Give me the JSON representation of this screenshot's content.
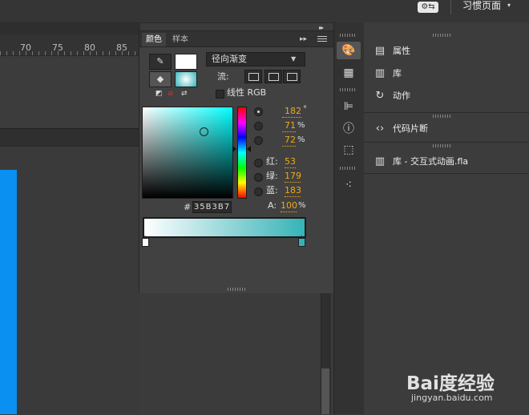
{
  "topbar": {
    "sync_icon": "gear-sync-icon",
    "workspace_label": "习惯页面",
    "workspace_caret": "▾"
  },
  "ruler": {
    "numbers": [
      "70",
      "75",
      "80",
      "85"
    ]
  },
  "color_panel": {
    "tabs": [
      "颜色",
      "样本"
    ],
    "expand_glyph": "▸▸",
    "type_select": "径向渐变",
    "flow_label": "流:",
    "linear_rgb_label": "线性 RGB",
    "channels": {
      "h": {
        "label": "",
        "value": "182",
        "unit": "°"
      },
      "s": {
        "label": "",
        "value": "71",
        "unit": "%"
      },
      "b": {
        "label": "",
        "value": "72",
        "unit": "%"
      },
      "r": {
        "label": "红:",
        "value": "53",
        "unit": ""
      },
      "g": {
        "label": "绿:",
        "value": "179",
        "unit": ""
      },
      "bl": {
        "label": "蓝:",
        "value": "183",
        "unit": ""
      }
    },
    "hex_hash": "#",
    "hex": "35B3B7",
    "alpha_label": "A:",
    "alpha_value": "100",
    "alpha_unit": "%",
    "colors": {
      "current": "#35b3b7",
      "start": "#ffffff"
    }
  },
  "right_panel": {
    "items": [
      {
        "label": "属性",
        "icon": "properties-icon"
      },
      {
        "label": "库",
        "icon": "library-icon"
      },
      {
        "label": "动作",
        "icon": "actions-icon"
      },
      {
        "label": "代码片断",
        "icon": "code-snippets-icon"
      },
      {
        "label": "库 - 交互式动画.fla",
        "icon": "library-file-icon"
      }
    ]
  },
  "watermark": {
    "logo": "Bai度经验",
    "url": "jingyan.baidu.com"
  }
}
